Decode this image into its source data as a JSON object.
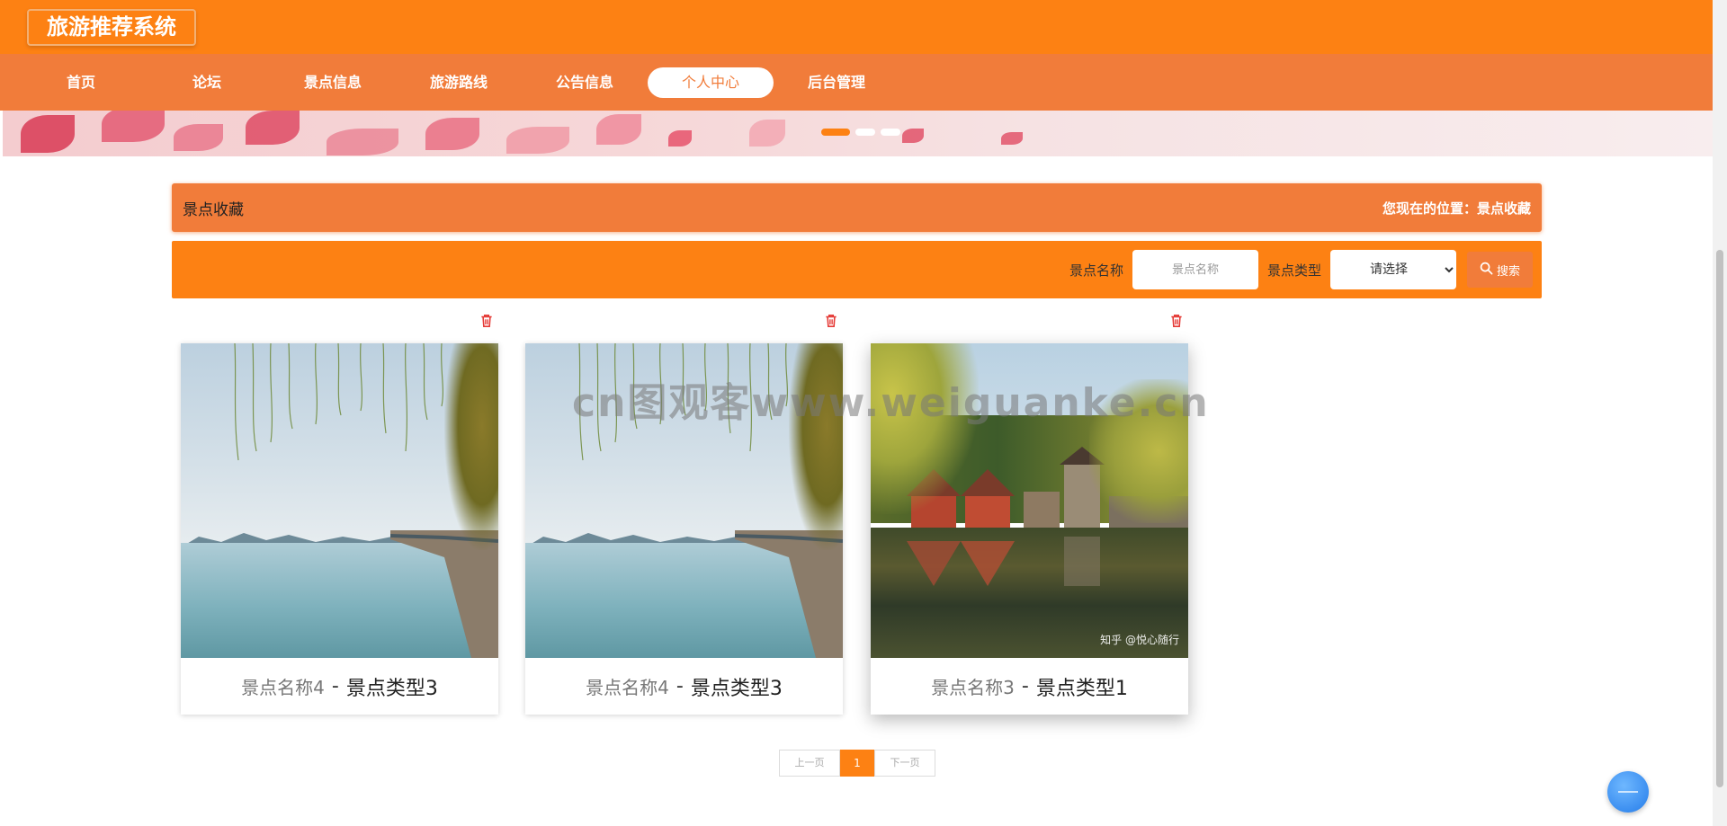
{
  "header": {
    "site_title": "旅游推荐系统"
  },
  "nav": {
    "items": [
      {
        "label": "首页"
      },
      {
        "label": "论坛"
      },
      {
        "label": "景点信息"
      },
      {
        "label": "旅游路线"
      },
      {
        "label": "公告信息"
      },
      {
        "label": "个人中心",
        "active": true
      },
      {
        "label": "后台管理"
      }
    ]
  },
  "banner": {
    "slide_count": 3,
    "active_index": 0
  },
  "section": {
    "title": "景点收藏",
    "location": "您现在的位置：景点收藏"
  },
  "search": {
    "name_label": "景点名称",
    "name_placeholder": "景点名称",
    "type_label": "景点类型",
    "type_selected": "请选择",
    "button_label": "搜索"
  },
  "cards": [
    {
      "name": "景点名称4",
      "separator": "-",
      "type": "景点类型3",
      "image": "lake-with-willows"
    },
    {
      "name": "景点名称4",
      "separator": "-",
      "type": "景点类型3",
      "image": "lake-with-willows"
    },
    {
      "name": "景点名称3",
      "separator": "-",
      "type": "景点类型1",
      "image": "palace-by-lake",
      "photo_credit": "知乎 @悦心随行"
    }
  ],
  "watermark": "cn图观客www.weiguanke.cn",
  "pagination": {
    "prev_label": "上一页",
    "current_page": "1",
    "next_label": "下一页"
  },
  "colors": {
    "header": "#fd8113",
    "nav": "#f17c3a",
    "accent": "#fd8113"
  },
  "icons": [
    "trash-icon",
    "search-icon",
    "chevron-down-icon"
  ]
}
